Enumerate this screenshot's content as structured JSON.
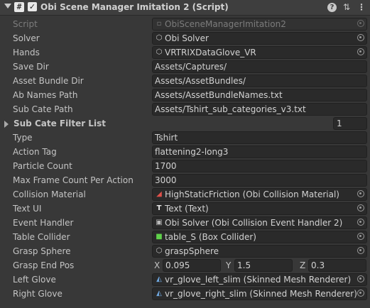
{
  "header": {
    "title": "Obi Scene Manager Imitation 2 (Script)",
    "enable_checked": "✓",
    "script_icon": "#",
    "icons": [
      "foldout-icon",
      "script-icon",
      "help-icon",
      "preset-icon",
      "more-options-icon"
    ]
  },
  "fields": {
    "script": {
      "label": "Script",
      "value": "ObiSceneManagerImitation2",
      "icon": "script-file-icon"
    },
    "solver": {
      "label": "Solver",
      "value": "Obi Solver",
      "icon": "cube-icon"
    },
    "hands": {
      "label": "Hands",
      "value": "VRTRIXDataGlove_VR",
      "icon": "cube-icon"
    },
    "save_dir": {
      "label": "Save Dir",
      "value": "Assets/Captures/"
    },
    "asset_bundle_dir": {
      "label": "Asset Bundle Dir",
      "value": "Assets/AssetBundles/"
    },
    "ab_names_path": {
      "label": "Ab Names Path",
      "value": "Assets/AssetBundleNames.txt"
    },
    "sub_cate_path": {
      "label": "Sub Cate Path",
      "value": "Assets/Tshirt_sub_categories_v3.txt"
    },
    "sub_cate_filter_list": {
      "label": "Sub Cate Filter List",
      "size": "1"
    },
    "type": {
      "label": "Type",
      "value": "Tshirt"
    },
    "action_tag": {
      "label": "Action Tag",
      "value": "flattening2-long3"
    },
    "particle_count": {
      "label": "Particle Count",
      "value": "1700"
    },
    "max_frame_count": {
      "label": "Max Frame Count Per Action",
      "value": "3000"
    },
    "collision_material": {
      "label": "Collision Material",
      "value": "HighStaticFriction (Obi Collision Material)",
      "icon": "material-icon"
    },
    "text_ui": {
      "label": "Text UI",
      "value": "Text (Text)",
      "icon": "text-icon"
    },
    "event_handler": {
      "label": "Event Handler",
      "value": "Obi Solver (Obi Collision Event Handler 2)",
      "icon": "solver-icon"
    },
    "table_collider": {
      "label": "Table Collider",
      "value": "table_S (Box Collider)",
      "icon": "collider-icon"
    },
    "grasp_sphere": {
      "label": "Grasp Sphere",
      "value": "graspSphere",
      "icon": "cube-icon"
    },
    "grasp_end_pos": {
      "label": "Grasp End Pos",
      "x_label": "X",
      "x": "0.095",
      "y_label": "Y",
      "y": "1.5",
      "z_label": "Z",
      "z": "0.3"
    },
    "left_glove": {
      "label": "Left Glove",
      "value": "vr_glove_left_slim (Skinned Mesh Renderer)",
      "icon": "skinned-mesh-icon"
    },
    "right_glove": {
      "label": "Right Glove",
      "value": "vr_glove_right_slim (Skinned Mesh Renderer)",
      "icon": "skinned-mesh-icon"
    }
  }
}
